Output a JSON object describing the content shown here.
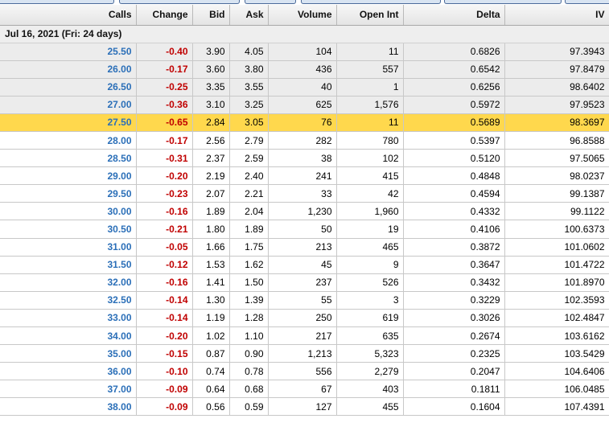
{
  "columns": [
    "Calls",
    "Change",
    "Bid",
    "Ask",
    "Volume",
    "Open Int",
    "Delta",
    "IV"
  ],
  "expiry_group": "Jul 16, 2021 (Fri: 24 days)",
  "colors": {
    "strike": "#2b6fb8",
    "change_negative": "#c00000",
    "highlight": "#ffd84d",
    "shaded": "#ececec"
  },
  "rows": [
    {
      "strike": "25.50",
      "change": "-0.40",
      "bid": "3.90",
      "ask": "4.05",
      "volume": "104",
      "open_int": "11",
      "delta": "0.6826",
      "iv": "97.3943"
    },
    {
      "strike": "26.00",
      "change": "-0.17",
      "bid": "3.60",
      "ask": "3.80",
      "volume": "436",
      "open_int": "557",
      "delta": "0.6542",
      "iv": "97.8479"
    },
    {
      "strike": "26.50",
      "change": "-0.25",
      "bid": "3.35",
      "ask": "3.55",
      "volume": "40",
      "open_int": "1",
      "delta": "0.6256",
      "iv": "98.6402"
    },
    {
      "strike": "27.00",
      "change": "-0.36",
      "bid": "3.10",
      "ask": "3.25",
      "volume": "625",
      "open_int": "1,576",
      "delta": "0.5972",
      "iv": "97.9523"
    },
    {
      "strike": "27.50",
      "change": "-0.65",
      "bid": "2.84",
      "ask": "3.05",
      "volume": "76",
      "open_int": "11",
      "delta": "0.5689",
      "iv": "98.3697"
    },
    {
      "strike": "28.00",
      "change": "-0.17",
      "bid": "2.56",
      "ask": "2.79",
      "volume": "282",
      "open_int": "780",
      "delta": "0.5397",
      "iv": "96.8588"
    },
    {
      "strike": "28.50",
      "change": "-0.31",
      "bid": "2.37",
      "ask": "2.59",
      "volume": "38",
      "open_int": "102",
      "delta": "0.5120",
      "iv": "97.5065"
    },
    {
      "strike": "29.00",
      "change": "-0.20",
      "bid": "2.19",
      "ask": "2.40",
      "volume": "241",
      "open_int": "415",
      "delta": "0.4848",
      "iv": "98.0237"
    },
    {
      "strike": "29.50",
      "change": "-0.23",
      "bid": "2.07",
      "ask": "2.21",
      "volume": "33",
      "open_int": "42",
      "delta": "0.4594",
      "iv": "99.1387"
    },
    {
      "strike": "30.00",
      "change": "-0.16",
      "bid": "1.89",
      "ask": "2.04",
      "volume": "1,230",
      "open_int": "1,960",
      "delta": "0.4332",
      "iv": "99.1122"
    },
    {
      "strike": "30.50",
      "change": "-0.21",
      "bid": "1.80",
      "ask": "1.89",
      "volume": "50",
      "open_int": "19",
      "delta": "0.4106",
      "iv": "100.6373"
    },
    {
      "strike": "31.00",
      "change": "-0.05",
      "bid": "1.66",
      "ask": "1.75",
      "volume": "213",
      "open_int": "465",
      "delta": "0.3872",
      "iv": "101.0602"
    },
    {
      "strike": "31.50",
      "change": "-0.12",
      "bid": "1.53",
      "ask": "1.62",
      "volume": "45",
      "open_int": "9",
      "delta": "0.3647",
      "iv": "101.4722"
    },
    {
      "strike": "32.00",
      "change": "-0.16",
      "bid": "1.41",
      "ask": "1.50",
      "volume": "237",
      "open_int": "526",
      "delta": "0.3432",
      "iv": "101.8970"
    },
    {
      "strike": "32.50",
      "change": "-0.14",
      "bid": "1.30",
      "ask": "1.39",
      "volume": "55",
      "open_int": "3",
      "delta": "0.3229",
      "iv": "102.3593"
    },
    {
      "strike": "33.00",
      "change": "-0.14",
      "bid": "1.19",
      "ask": "1.28",
      "volume": "250",
      "open_int": "619",
      "delta": "0.3026",
      "iv": "102.4847"
    },
    {
      "strike": "34.00",
      "change": "-0.20",
      "bid": "1.02",
      "ask": "1.10",
      "volume": "217",
      "open_int": "635",
      "delta": "0.2674",
      "iv": "103.6162"
    },
    {
      "strike": "35.00",
      "change": "-0.15",
      "bid": "0.87",
      "ask": "0.90",
      "volume": "1,213",
      "open_int": "5,323",
      "delta": "0.2325",
      "iv": "103.5429"
    },
    {
      "strike": "36.00",
      "change": "-0.10",
      "bid": "0.74",
      "ask": "0.78",
      "volume": "556",
      "open_int": "2,279",
      "delta": "0.2047",
      "iv": "104.6406"
    },
    {
      "strike": "37.00",
      "change": "-0.09",
      "bid": "0.64",
      "ask": "0.68",
      "volume": "67",
      "open_int": "403",
      "delta": "0.1811",
      "iv": "106.0485"
    },
    {
      "strike": "38.00",
      "change": "-0.09",
      "bid": "0.56",
      "ask": "0.59",
      "volume": "127",
      "open_int": "455",
      "delta": "0.1604",
      "iv": "107.4391"
    }
  ]
}
